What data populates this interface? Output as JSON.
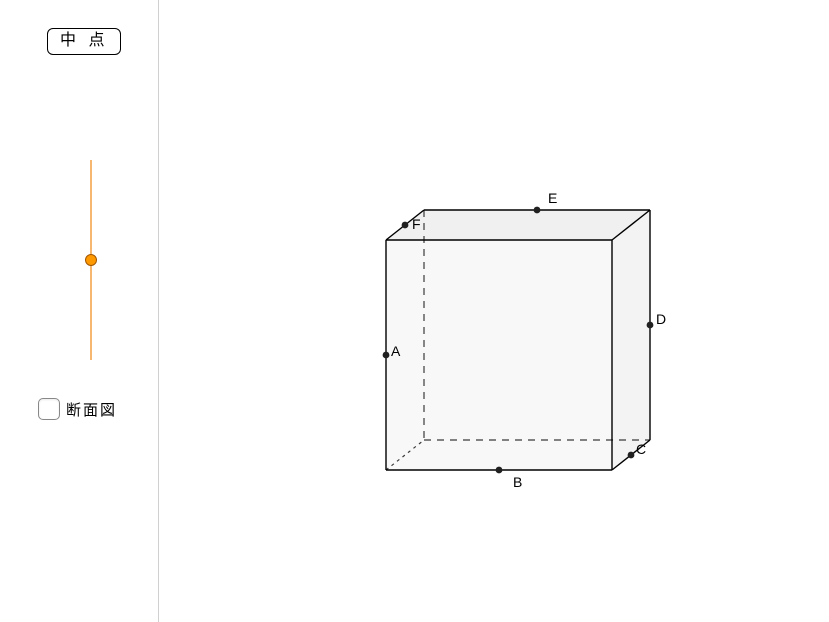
{
  "controls": {
    "midpoint_button_label": "中 点",
    "section_checkbox_label": "断面図",
    "section_checkbox_checked": false,
    "slider": {
      "min": 0,
      "max": 1,
      "value": 0.5
    }
  },
  "cube": {
    "points": {
      "A": {
        "label": "A"
      },
      "B": {
        "label": "B"
      },
      "C": {
        "label": "C"
      },
      "D": {
        "label": "D"
      },
      "E": {
        "label": "E"
      },
      "F": {
        "label": "F"
      }
    },
    "colors": {
      "edge": "#000000",
      "face_fill": "#f4f4f4",
      "face_fill_top": "#eeeeee",
      "hidden_edge": "#3a3a3a",
      "point_fill": "#202020"
    }
  },
  "chart_data": {
    "type": "diagram",
    "shape": "cube",
    "description": "3D cube with six labeled midpoints on edges",
    "labels": [
      "A",
      "B",
      "C",
      "D",
      "E",
      "F"
    ],
    "label_positions": {
      "A": "midpoint of front-left vertical edge",
      "B": "midpoint of front-bottom edge",
      "C": "midpoint of right-bottom edge",
      "D": "midpoint of back-right vertical edge",
      "E": "midpoint of top-back edge",
      "F": "midpoint of top-left edge"
    },
    "slider_controls": "midpoint position parameter",
    "checkbox_toggles": "cross-section display"
  }
}
